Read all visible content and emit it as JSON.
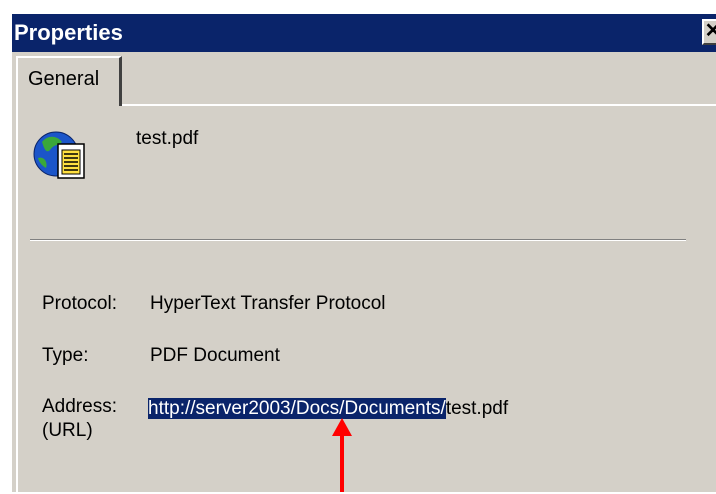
{
  "dialog": {
    "title": "Properties",
    "close_glyph": "✕",
    "tab_label": "General",
    "file_icon": "internet-document-icon",
    "file_name": "test.pdf",
    "protocol": {
      "label": "Protocol:",
      "value": "HyperText Transfer Protocol"
    },
    "type": {
      "label": "Type:",
      "value": "PDF Document"
    },
    "address": {
      "label_line1": "Address:",
      "label_line2": "(URL)",
      "value_selected": "http://server2003/Docs/Documents/",
      "value_rest": "test.pdf"
    }
  },
  "annotation": {
    "icon": "red-up-arrow-icon",
    "color": "#ff0000"
  },
  "colors": {
    "titlebar": "#0a246a",
    "dialog_bg": "#d4d0c8",
    "selection": "#0a246a"
  }
}
